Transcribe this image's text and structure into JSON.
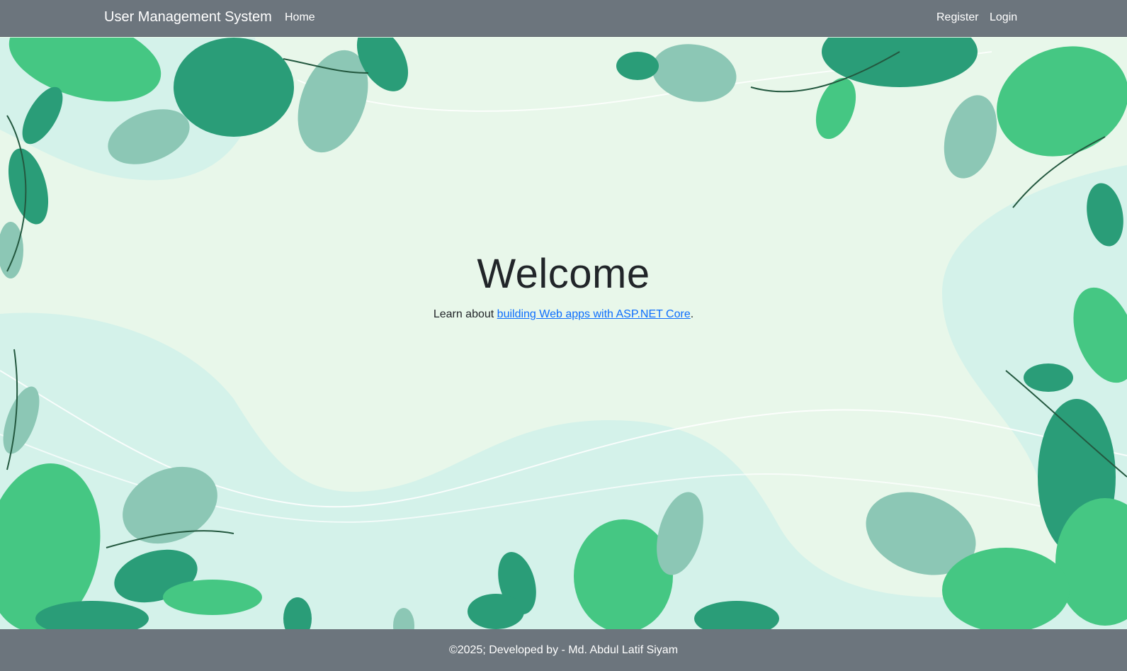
{
  "navbar": {
    "brand": "User Management System",
    "links": {
      "home": "Home",
      "register": "Register",
      "login": "Login"
    }
  },
  "main": {
    "heading": "Welcome",
    "learn_prefix": "Learn about ",
    "learn_link": "building Web apps with ASP.NET Core",
    "learn_suffix": "."
  },
  "footer": {
    "text": "©2025; Developed by - Md. Abdul Latif Siyam"
  },
  "colors": {
    "navbar_bg": "#6c757d",
    "hero_bg": "#e8f7ea",
    "link": "#0d6efd",
    "leaf_dark": "#2a9d78",
    "leaf_mid": "#45c783",
    "leaf_pale": "#8cc7b5"
  },
  "icons": [
    "leaf-decoration"
  ]
}
